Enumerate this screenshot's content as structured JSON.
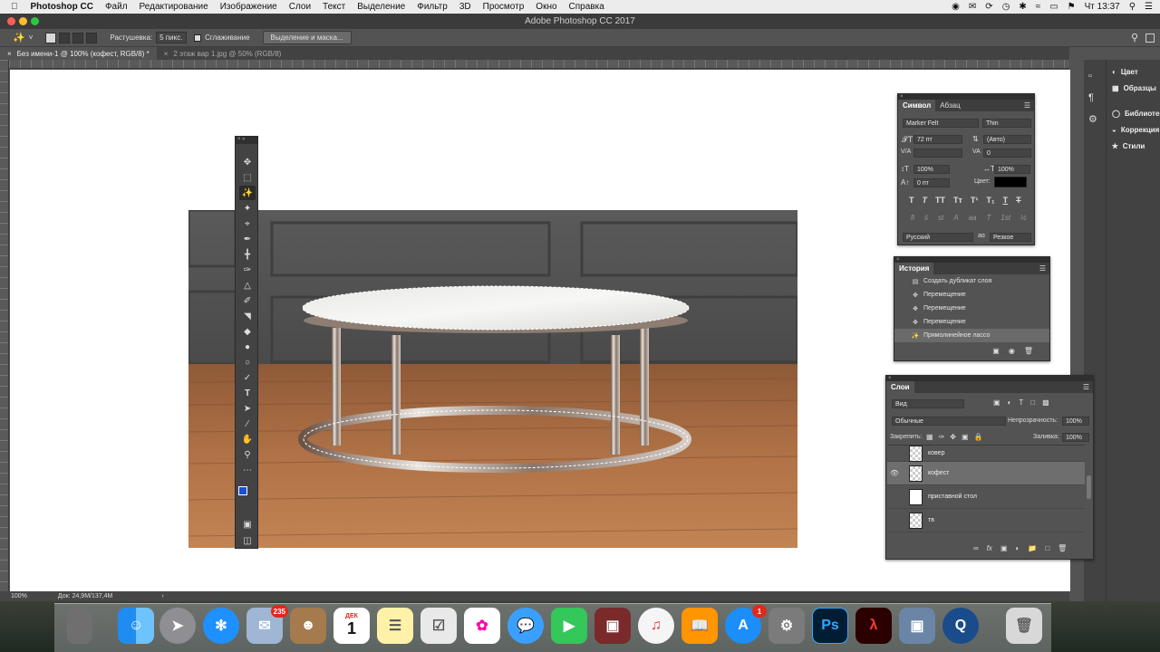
{
  "menubar": {
    "app_name": "Photoshop CC",
    "items": [
      "Файл",
      "Редактирование",
      "Изображение",
      "Слои",
      "Текст",
      "Выделение",
      "Фильтр",
      "3D",
      "Просмотр",
      "Окно",
      "Справка"
    ],
    "clock": "Чт 13:37"
  },
  "window": {
    "title": "Adobe Photoshop CC 2017"
  },
  "options": {
    "feather_label": "Растушевка:",
    "feather_value": "5 пикс.",
    "antialias_label": "Сглаживание",
    "select_mask_label": "Выделение и маска..."
  },
  "tabs": [
    {
      "label": "Без имени-1 @ 100% (кофест, RGB/8) *"
    },
    {
      "label": "2 этаж вар 1.jpg @ 50% (RGB/8)"
    }
  ],
  "status": {
    "zoom": "100%",
    "doc": "Док: 24,9M/137,4M"
  },
  "right_dock": [
    "Цвет",
    "Образцы",
    "Библиотеки",
    "Коррекция",
    "Стили"
  ],
  "character": {
    "tabs": [
      "Символ",
      "Абзац"
    ],
    "font_family": "Marker Felt",
    "font_style": "Thin",
    "size": "72 пт",
    "leading": "(Авто)",
    "kerning": "",
    "tracking": "0",
    "vscale": "100%",
    "hscale": "100%",
    "baseline": "0 пт",
    "color_label": "Цвет:",
    "language": "Русский",
    "aa_mark": "aɑ",
    "antialias": "Резкое"
  },
  "history": {
    "title": "История",
    "items": [
      "Создать дубликат слоя",
      "Перемещение",
      "Перемещение",
      "Перемещение",
      "Прямолинейное лассо"
    ]
  },
  "layers": {
    "title": "Слои",
    "filter": "Вид",
    "blend_mode": "Обычные",
    "opacity_label": "Непрозрачность:",
    "opacity": "100%",
    "lock_label": "Закрепить:",
    "fill_label": "Заливка:",
    "fill": "100%",
    "items": [
      {
        "name": "ковер"
      },
      {
        "name": "кофест"
      },
      {
        "name": "приставной стол"
      },
      {
        "name": "тв"
      }
    ]
  },
  "dock": {
    "mail_badge": "235",
    "calendar_month": "ДЕК",
    "calendar_day": "1",
    "appstore_badge": "1",
    "ps_label": "Ps"
  },
  "colors": {
    "foreground": "#1a4fd6",
    "background": "#000000",
    "accent": "#2b2b2b"
  }
}
